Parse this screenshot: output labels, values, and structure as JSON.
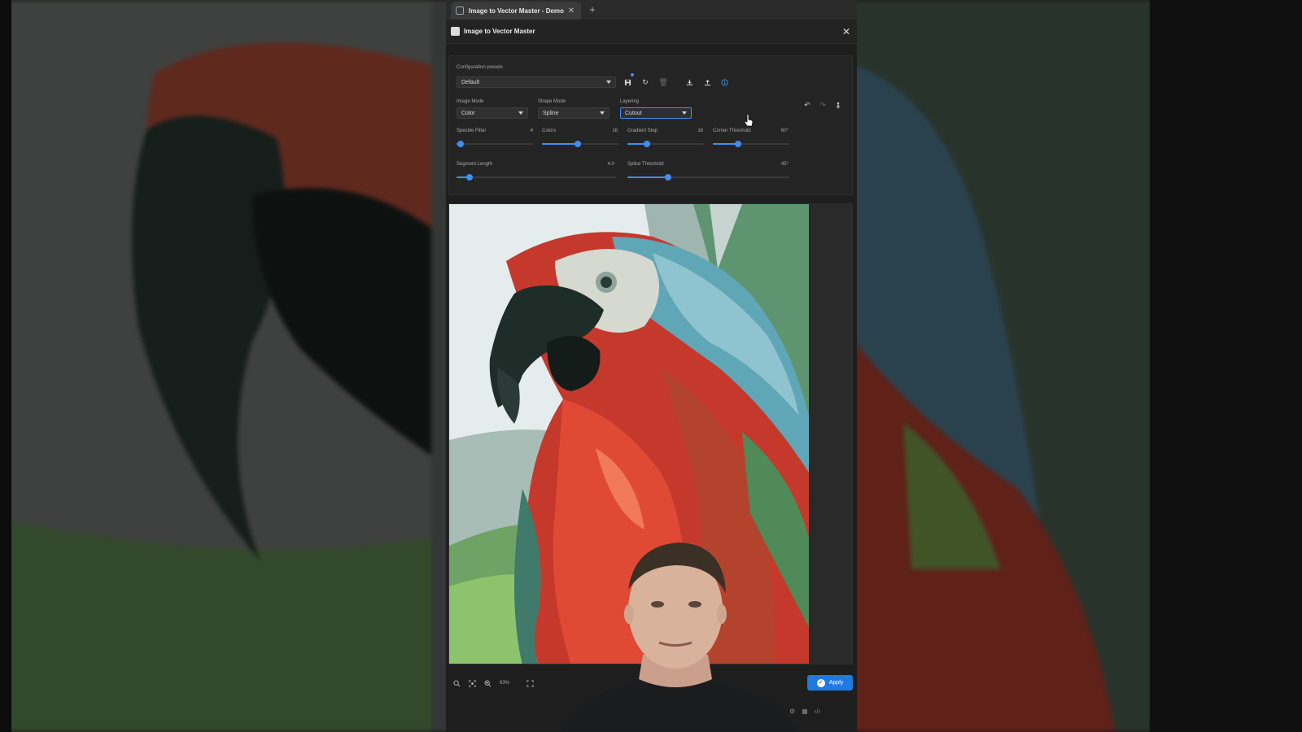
{
  "browser": {
    "tab_title": "Image to Vector Master - Demo",
    "new_tab_symbol": "+"
  },
  "dialog": {
    "title": "Image to Vector Master"
  },
  "presets": {
    "label": "Configuration presets",
    "selected": "Default"
  },
  "modes": {
    "image_mode_label": "Image Mode",
    "image_mode_value": "Color",
    "shape_mode_label": "Shape Mode",
    "shape_mode_value": "Spline",
    "layering_label": "Layering",
    "layering_value": "Cutout"
  },
  "sliders": [
    {
      "label": "Speckle Filter",
      "value_text": "4",
      "fraction": 0.05
    },
    {
      "label": "Colors",
      "value_text": "16",
      "fraction": 0.47
    },
    {
      "label": "Gradient Step",
      "value_text": "16",
      "fraction": 0.25
    },
    {
      "label": "Corner Threshold",
      "value_text": "60°",
      "fraction": 0.33
    },
    {
      "label": "Segment Length",
      "value_text": "4.0",
      "fraction": 0.08
    },
    {
      "label": "Splice Threshold",
      "value_text": "45°",
      "fraction": 0.25
    }
  ],
  "zoom": {
    "level": "63%"
  },
  "apply": {
    "label": "Apply"
  },
  "colors": {
    "accent": "#3f8ff0",
    "apply_button": "#1f7ae0"
  }
}
